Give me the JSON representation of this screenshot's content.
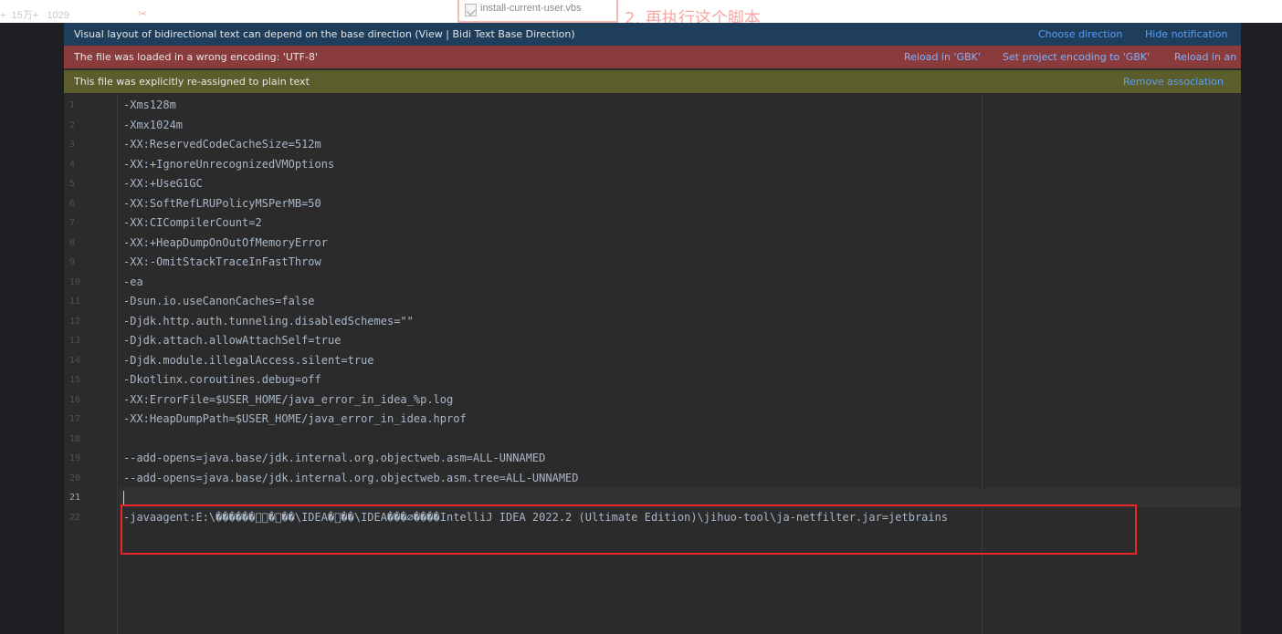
{
  "top_strip": {
    "stats": "+  15万+   1029",
    "favorite_glyph": "✂",
    "file_name": "install-current-user.vbs",
    "annotation": "2. 再执行这个脚本"
  },
  "banners": {
    "bidi": {
      "message": "Visual layout of bidirectional text can depend on the base direction (View | Bidi Text Base Direction)",
      "actions": [
        "Choose direction",
        "Hide notification"
      ]
    },
    "encoding": {
      "message": "The file was loaded in a wrong encoding: 'UTF-8'",
      "actions": [
        "Reload in 'GBK'",
        "Set project encoding to 'GBK'",
        "Reload in an"
      ]
    },
    "plain_text": {
      "message": "This file was explicitly re-assigned to plain text",
      "actions": [
        "Remove association"
      ]
    }
  },
  "editor": {
    "current_line": 21,
    "lines": [
      "-Xms128m",
      "-Xmx1024m",
      "-XX:ReservedCodeCacheSize=512m",
      "-XX:+IgnoreUnrecognizedVMOptions",
      "-XX:+UseG1GC",
      "-XX:SoftRefLRUPolicyMSPerMB=50",
      "-XX:CICompilerCount=2",
      "-XX:+HeapDumpOnOutOfMemoryError",
      "-XX:-OmitStackTraceInFastThrow",
      "-ea",
      "-Dsun.io.useCanonCaches=false",
      "-Djdk.http.auth.tunneling.disabledSchemes=\"\"",
      "-Djdk.attach.allowAttachSelf=true",
      "-Djdk.module.illegalAccess.silent=true",
      "-Dkotlinx.coroutines.debug=off",
      "-XX:ErrorFile=$USER_HOME/java_error_in_idea_%p.log",
      "-XX:HeapDumpPath=$USER_HOME/java_error_in_idea.hprof",
      "",
      "--add-opens=java.base/jdk.internal.org.objectweb.asm=ALL-UNNAMED",
      "--add-opens=java.base/jdk.internal.org.objectweb.asm.tree=ALL-UNNAMED",
      "",
      "-javaagent:E:\\������\u0000\u0000�\u0000��\\IDEA�\u0000��\\IDEA���∅����IntelliJ IDEA 2022.2 (Ultimate Edition)\\jihuo-tool\\ja-netfilter.jar=jetbrains"
    ]
  },
  "colors": {
    "highlight_box": "#e8262c",
    "bidi_banner": "#1f3e5c",
    "encoding_banner": "#8a3b3b",
    "plain_banner": "#5b5e2c",
    "link": "#589df6"
  }
}
